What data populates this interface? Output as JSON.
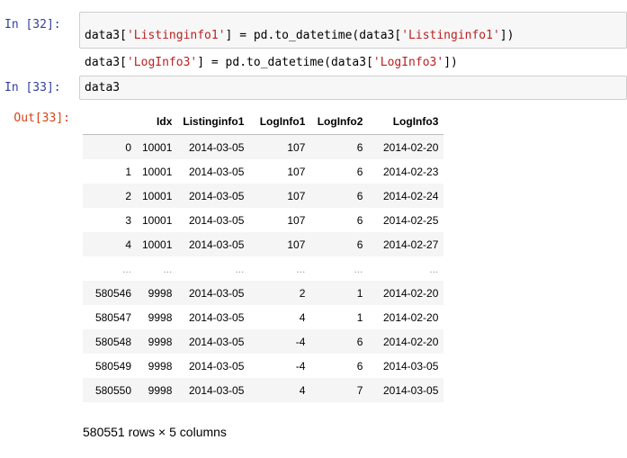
{
  "cells": [
    {
      "prompt": "In  [32]:",
      "code_lines": [
        [
          "data3[",
          "'Listinginfo1'",
          "] = pd.to_datetime(data3[",
          "'Listinginfo1'",
          "])"
        ],
        [
          "data3[",
          "'LogInfo3'",
          "] = pd.to_datetime(data3[",
          "'LogInfo3'",
          "])"
        ]
      ]
    },
    {
      "prompt": "In  [33]:",
      "code": "data3"
    }
  ],
  "output": {
    "prompt": "Out[33]:",
    "columns": [
      "",
      "Idx",
      "Listinginfo1",
      "LogInfo1",
      "LogInfo2",
      "LogInfo3"
    ],
    "rows": [
      [
        "0",
        "10001",
        "2014-03-05",
        "107",
        "6",
        "2014-02-20"
      ],
      [
        "1",
        "10001",
        "2014-03-05",
        "107",
        "6",
        "2014-02-23"
      ],
      [
        "2",
        "10001",
        "2014-03-05",
        "107",
        "6",
        "2014-02-24"
      ],
      [
        "3",
        "10001",
        "2014-03-05",
        "107",
        "6",
        "2014-02-25"
      ],
      [
        "4",
        "10001",
        "2014-03-05",
        "107",
        "6",
        "2014-02-27"
      ],
      [
        "...",
        "...",
        "...",
        "...",
        "...",
        "..."
      ],
      [
        "580546",
        "9998",
        "2014-03-05",
        "2",
        "1",
        "2014-02-20"
      ],
      [
        "580547",
        "9998",
        "2014-03-05",
        "4",
        "1",
        "2014-02-20"
      ],
      [
        "580548",
        "9998",
        "2014-03-05",
        "-4",
        "6",
        "2014-02-20"
      ],
      [
        "580549",
        "9998",
        "2014-03-05",
        "-4",
        "6",
        "2014-03-05"
      ],
      [
        "580550",
        "9998",
        "2014-03-05",
        "4",
        "7",
        "2014-03-05"
      ]
    ],
    "summary": "580551 rows × 5 columns"
  }
}
